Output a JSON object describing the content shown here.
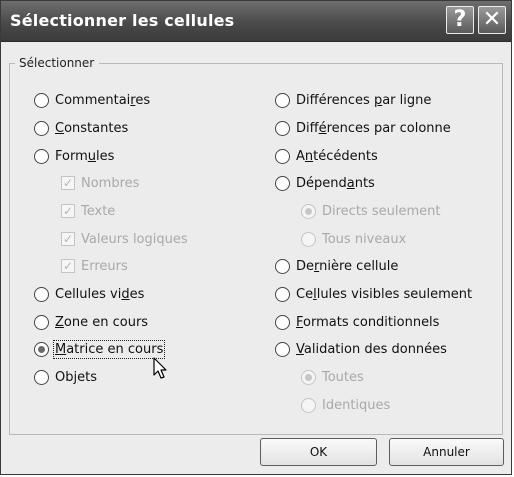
{
  "dialog": {
    "title": "Sélectionner les cellules",
    "help_icon": "question-mark-icon",
    "close_icon": "close-x-icon",
    "group_label": "Sélectionner"
  },
  "left_options": [
    {
      "pre": "Commentai",
      "acc": "r",
      "post": "es"
    },
    {
      "pre": "",
      "acc": "C",
      "post": "onstantes"
    },
    {
      "pre": "Form",
      "acc": "u",
      "post": "les"
    },
    {
      "pre": "Cellules vi",
      "acc": "d",
      "post": "es"
    },
    {
      "pre": "",
      "acc": "Z",
      "post": "one en cours"
    },
    {
      "pre": "",
      "acc": "M",
      "post": "atrice en cours"
    },
    {
      "pre": "Ob",
      "acc": "j",
      "post": "ets"
    }
  ],
  "formula_checks": [
    "Nombres",
    "Texte",
    "Valeurs logiques",
    "Erreurs"
  ],
  "right_options": [
    {
      "pre": "Différences ",
      "acc": "p",
      "post": "ar ligne"
    },
    {
      "pre": "Diff",
      "acc": "é",
      "post": "rences par colonne"
    },
    {
      "pre": "A",
      "acc": "n",
      "post": "técédents"
    },
    {
      "pre": "Dépend",
      "acc": "a",
      "post": "nts"
    },
    {
      "pre": "De",
      "acc": "r",
      "post": "nière cellule"
    },
    {
      "pre": "Ce",
      "acc": "l",
      "post": "lules visibles seulement"
    },
    {
      "pre": "",
      "acc": "F",
      "post": "ormats conditionnels"
    },
    {
      "pre": "",
      "acc": "V",
      "post": "alidation des données"
    }
  ],
  "dependents_sub": [
    "Directs seulement",
    "Tous niveaux"
  ],
  "validation_sub": [
    "Toutes",
    "Identiques"
  ],
  "buttons": {
    "ok": "OK",
    "cancel": "Annuler"
  }
}
